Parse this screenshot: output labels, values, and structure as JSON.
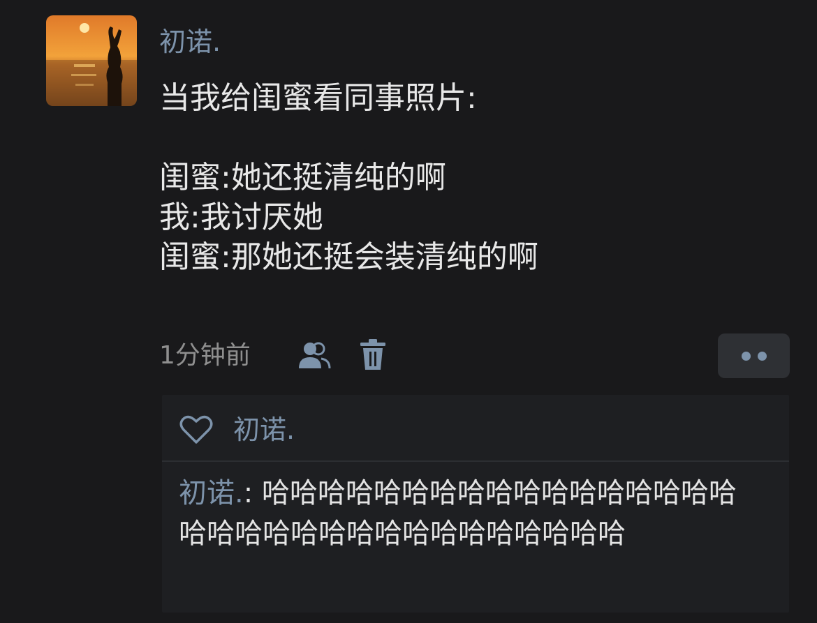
{
  "post": {
    "author": "初诺.",
    "lines": [
      "当我给闺蜜看同事照片:",
      "",
      "闺蜜:她还挺清纯的啊",
      "我:我讨厌她",
      "闺蜜:那她还挺会装清纯的啊"
    ],
    "time": "1分钟前",
    "icons": {
      "avatar": "sunset-silhouette-avatar",
      "visibility": "people-icon",
      "delete": "trash-icon",
      "more": "more-dots-icon",
      "like": "heart-icon"
    }
  },
  "likes": {
    "names": "初诺."
  },
  "comments": [
    {
      "author": "初诺.",
      "separator": ": ",
      "text": "哈哈哈哈哈哈哈哈哈哈哈哈哈哈哈哈哈哈哈哈哈哈哈哈哈哈哈哈哈哈哈哈哈"
    }
  ],
  "colors": {
    "background": "#19191b",
    "name_link": "#7d93ab",
    "panel": "#1e1f22",
    "more_button": "#2e3034",
    "meta_text": "#8f8f8f"
  }
}
